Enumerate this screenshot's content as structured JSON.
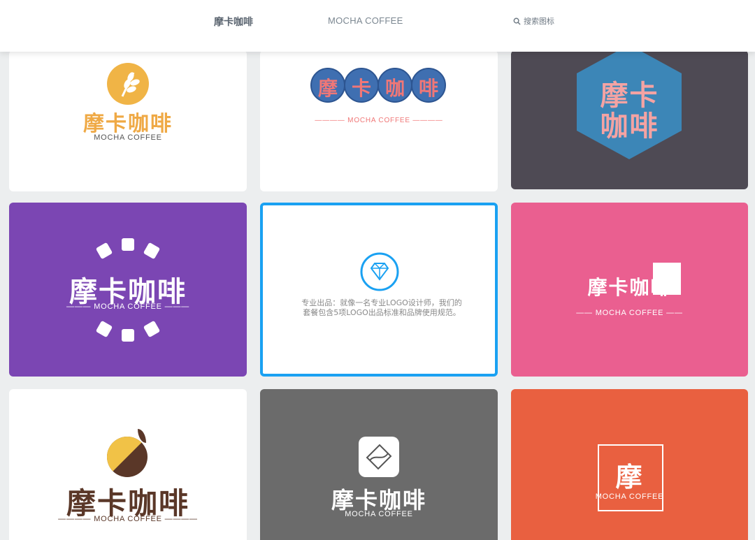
{
  "header": {
    "brand": "摩卡咖啡",
    "subtitle": "MOCHA COFFEE",
    "search_label": "搜索图标"
  },
  "cards": {
    "c1": {
      "cn": "摩卡咖啡",
      "en": "MOCHA COFFEE"
    },
    "c2": {
      "chars": [
        "摩",
        "卡",
        "咖",
        "啡"
      ],
      "en": "———— MOCHA COFFEE ————"
    },
    "c3": {
      "line1": "摩卡",
      "line2": "咖啡"
    },
    "c4": {
      "cn": "摩卡咖啡",
      "en": "——— MOCHA COFFEE ———"
    },
    "c5": {
      "desc": "专业出品：就像一名专业LOGO设计师，我们的套餐包含5项LOGO出品标准和品牌使用规范。"
    },
    "c6": {
      "cn": "摩卡咖啡",
      "en": "—— MOCHA COFFEE ——"
    },
    "c7": {
      "cn": "摩卡咖啡",
      "en": "———— MOCHA COFFEE ————"
    },
    "c8": {
      "cn": "摩卡咖啡",
      "en": "MOCHA COFFEE"
    },
    "c9": {
      "cn": "摩",
      "en": "MOCHA COFFEE"
    }
  },
  "colors": {
    "selected_border": "#1aa1f2",
    "purple": "#7b46b3",
    "pink": "#ea5f90",
    "orange": "#e96040"
  }
}
